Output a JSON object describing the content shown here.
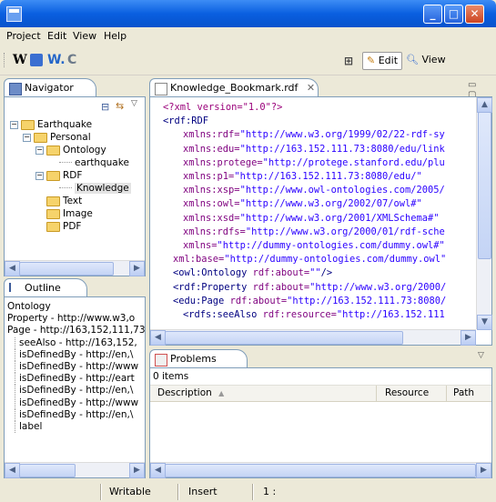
{
  "menu": [
    "Project",
    "Edit",
    "View",
    "Help"
  ],
  "toolbar": {
    "icons": [
      "W",
      "W.",
      "C"
    ],
    "perspectives": {
      "edit": "Edit",
      "view": "View"
    }
  },
  "navigator": {
    "tab": "Navigator",
    "tree": [
      {
        "label": "Earthquake",
        "indent": 0,
        "expander": "−",
        "icon": "folder"
      },
      {
        "label": "Personal",
        "indent": 1,
        "expander": "−",
        "icon": "folder"
      },
      {
        "label": "Ontology",
        "indent": 2,
        "expander": "−",
        "icon": "folder"
      },
      {
        "label": "earthquake",
        "indent": 3,
        "expander": "",
        "icon": "file"
      },
      {
        "label": "RDF",
        "indent": 2,
        "expander": "−",
        "icon": "folder"
      },
      {
        "label": "Knowledge",
        "indent": 3,
        "expander": "",
        "icon": "file",
        "selected": true
      },
      {
        "label": "Text",
        "indent": 2,
        "expander": "",
        "icon": "folder"
      },
      {
        "label": "Image",
        "indent": 2,
        "expander": "",
        "icon": "folder"
      },
      {
        "label": "PDF",
        "indent": 2,
        "expander": "",
        "icon": "folder"
      }
    ]
  },
  "outline": {
    "tab": "Outline",
    "rows": [
      {
        "text": "Ontology",
        "indent": 0
      },
      {
        "text": "Property - http://www.w3,o",
        "indent": 0
      },
      {
        "text": "Page - http://163,152,111,73",
        "indent": 0
      },
      {
        "text": "seeAlso - http://163,152,",
        "indent": 1
      },
      {
        "text": "isDefinedBy - http://en,\\",
        "indent": 1
      },
      {
        "text": "isDefinedBy - http://www",
        "indent": 1
      },
      {
        "text": "isDefinedBy - http://eart",
        "indent": 1
      },
      {
        "text": "isDefinedBy - http://en,\\",
        "indent": 1
      },
      {
        "text": "isDefinedBy - http://www",
        "indent": 1
      },
      {
        "text": "isDefinedBy - http://en,\\",
        "indent": 1
      },
      {
        "text": "label",
        "indent": 1
      }
    ]
  },
  "editor": {
    "tab": "Knowledge_Bookmark.rdf",
    "lines": [
      {
        "indent": 0,
        "parts": [
          [
            "pi",
            "<?xml version=\"1.0\"?>"
          ]
        ]
      },
      {
        "indent": 0,
        "parts": [
          [
            "tag",
            "<rdf:RDF"
          ]
        ]
      },
      {
        "indent": 2,
        "parts": [
          [
            "attr",
            "xmlns:rdf="
          ],
          [
            "val",
            "\"http://www.w3.org/1999/02/22-rdf-sy"
          ]
        ]
      },
      {
        "indent": 2,
        "parts": [
          [
            "attr",
            "xmlns:edu="
          ],
          [
            "val",
            "\"http://163.152.111.73:8080/edu/link"
          ]
        ]
      },
      {
        "indent": 2,
        "parts": [
          [
            "attr",
            "xmlns:protege="
          ],
          [
            "val",
            "\"http://protege.stanford.edu/plu"
          ]
        ]
      },
      {
        "indent": 2,
        "parts": [
          [
            "attr",
            "xmlns:p1="
          ],
          [
            "val",
            "\"http://163.152.111.73:8080/edu/\""
          ]
        ]
      },
      {
        "indent": 2,
        "parts": [
          [
            "attr",
            "xmlns:xsp="
          ],
          [
            "val",
            "\"http://www.owl-ontologies.com/2005/"
          ]
        ]
      },
      {
        "indent": 2,
        "parts": [
          [
            "attr",
            "xmlns:owl="
          ],
          [
            "val",
            "\"http://www.w3.org/2002/07/owl#\""
          ]
        ]
      },
      {
        "indent": 2,
        "parts": [
          [
            "attr",
            "xmlns:xsd="
          ],
          [
            "val",
            "\"http://www.w3.org/2001/XMLSchema#\""
          ]
        ]
      },
      {
        "indent": 2,
        "parts": [
          [
            "attr",
            "xmlns:rdfs="
          ],
          [
            "val",
            "\"http://www.w3.org/2000/01/rdf-sche"
          ]
        ]
      },
      {
        "indent": 2,
        "parts": [
          [
            "attr",
            "xmlns="
          ],
          [
            "val",
            "\"http://dummy-ontologies.com/dummy.owl#\""
          ]
        ]
      },
      {
        "indent": 1,
        "parts": [
          [
            "attr",
            "xml:base="
          ],
          [
            "val",
            "\"http://dummy-ontologies.com/dummy.owl\""
          ]
        ]
      },
      {
        "indent": 1,
        "parts": [
          [
            "tag",
            "<owl:Ontology "
          ],
          [
            "attr",
            "rdf:about="
          ],
          [
            "val",
            "\"\""
          ],
          [
            "tag",
            "/>"
          ]
        ]
      },
      {
        "indent": 1,
        "parts": [
          [
            "tag",
            "<rdf:Property "
          ],
          [
            "attr",
            "rdf:about="
          ],
          [
            "val",
            "\"http://www.w3.org/2000/"
          ]
        ]
      },
      {
        "indent": 1,
        "parts": [
          [
            "tag",
            "<edu:Page "
          ],
          [
            "attr",
            "rdf:about="
          ],
          [
            "val",
            "\"http://163.152.111.73:8080/"
          ]
        ]
      },
      {
        "indent": 2,
        "parts": [
          [
            "tag",
            "<rdfs:seeAlso "
          ],
          [
            "attr",
            "rdf:resource="
          ],
          [
            "val",
            "\"http://163.152.111"
          ]
        ]
      }
    ]
  },
  "problems": {
    "tab": "Problems",
    "count": "0 items",
    "columns": [
      "Description",
      "Resource",
      "Path"
    ]
  },
  "status": {
    "writable": "Writable",
    "insert": "Insert",
    "position": "1 :"
  },
  "colors": {
    "titlebar": "#0a5fe0",
    "accent": "#7f9db9"
  }
}
